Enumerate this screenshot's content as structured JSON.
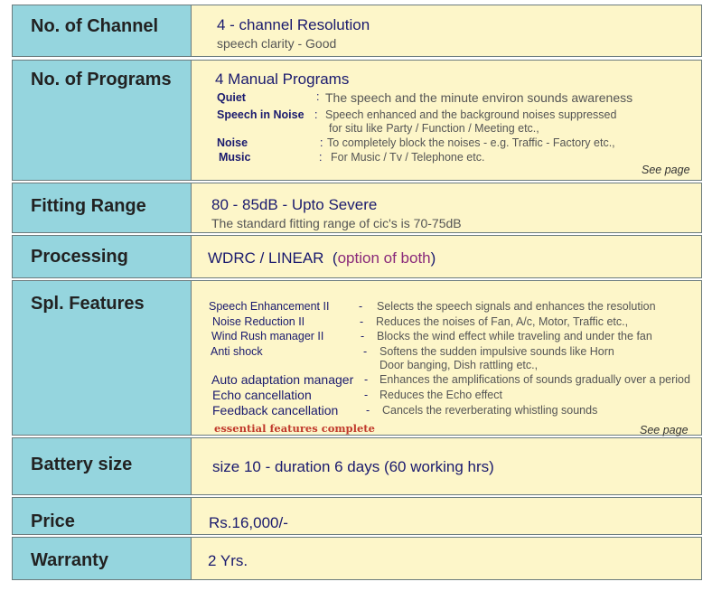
{
  "rows": {
    "channel": {
      "label": "No. of Channel",
      "main": "4 -  channel Resolution",
      "sub": "speech clarity -  Good"
    },
    "programs": {
      "label": "No. of Programs",
      "main": "4  Manual Programs",
      "items": [
        {
          "name": "Quiet",
          "sep": ":",
          "desc": "The speech and the minute environ sounds awareness"
        },
        {
          "name": "Speech in Noise",
          "sep": ":",
          "desc": "Speech enhanced and the background noises suppressed",
          "desc2": "for situ like Party / Function / Meeting etc.,"
        },
        {
          "name": "Noise",
          "sep": ":",
          "desc": "To completely block the noises - e.g. Traffic - Factory etc.,"
        },
        {
          "name": "Music",
          "sep": ":",
          "desc": "For Music / Tv / Telephone etc."
        }
      ],
      "see_page": "See page"
    },
    "fitting": {
      "label": "Fitting Range",
      "main": "80 - 85dB - Upto Severe",
      "sub": "The standard fitting range of cic's is 70-75dB"
    },
    "processing": {
      "label": "Processing",
      "main": "WDRC / LINEAR",
      "paren_open": "(",
      "option": "option of both",
      "paren_close": ")"
    },
    "features": {
      "label": "Spl. Features",
      "items": [
        {
          "name": "Speech Enhancement II",
          "sep": "-",
          "desc": "Selects  the speech signals and enhances the resolution"
        },
        {
          "name": "Noise Reduction II",
          "sep": "-",
          "desc": "Reduces the noises of Fan, A/c, Motor, Traffic etc.,"
        },
        {
          "name": "Wind Rush manager II",
          "sep": "-",
          "desc": "Blocks the wind effect while traveling and under the fan"
        },
        {
          "name": "Anti shock",
          "sep": "-",
          "desc": "Softens the sudden impulsive sounds like Horn",
          "desc2": "Door banging, Dish rattling etc.,"
        },
        {
          "name": "Auto adaptation manager",
          "sep": "-",
          "desc": "Enhances the amplifications of sounds gradually over a period"
        },
        {
          "name": "Echo cancellation",
          "sep": "-",
          "desc": "Reduces the Echo effect"
        },
        {
          "name": "Feedback cancellation",
          "sep": "-",
          "desc": "Cancels the reverberating whistling sounds"
        }
      ],
      "note": "essential features complete",
      "see_page": "See page"
    },
    "battery": {
      "label": "Battery size",
      "main": "size 10 - duration 6 days (60 working hrs)"
    },
    "price": {
      "label": "Price",
      "main": "Rs.16,000/-"
    },
    "warranty": {
      "label": "Warranty",
      "main": "2 Yrs."
    }
  },
  "colors": {
    "label_bg": "#95d5de",
    "value_bg": "#fdf6c9",
    "text_navy": "#1a1a6e",
    "accent_purple": "#8a2a7a",
    "note_red": "#c0392b"
  }
}
